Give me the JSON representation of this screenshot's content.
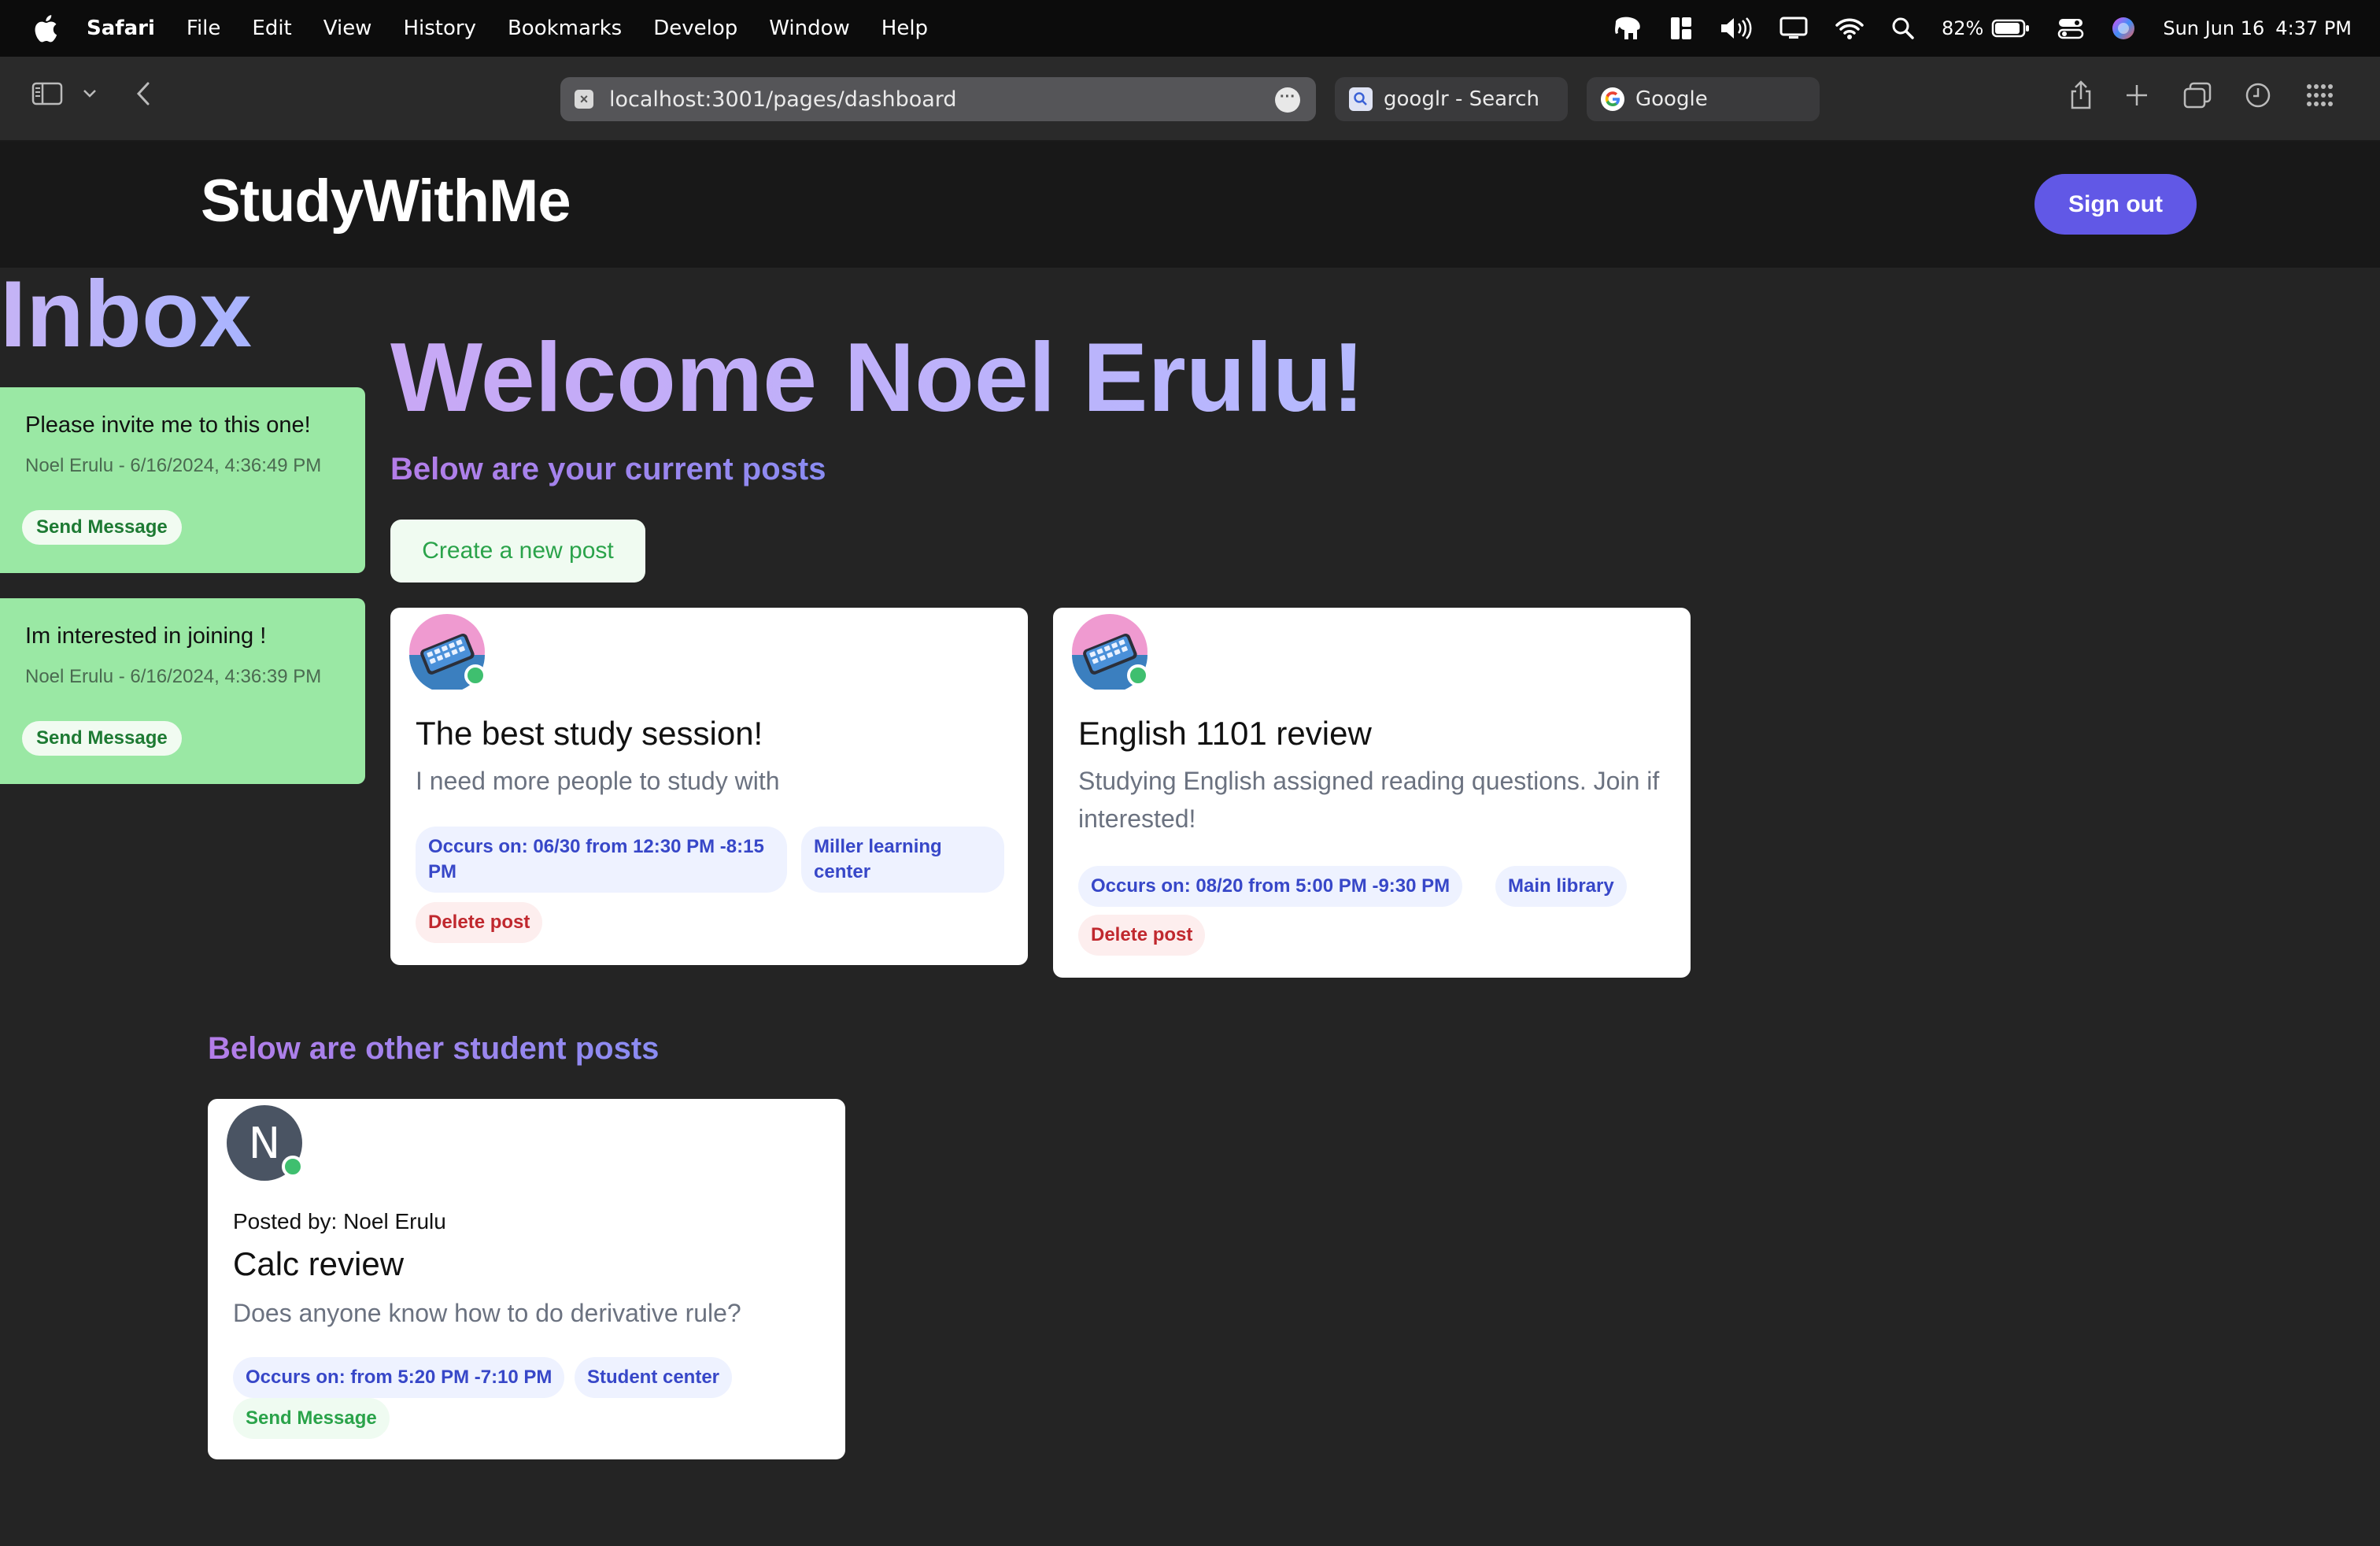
{
  "menubar": {
    "app_name": "Safari",
    "items": [
      "File",
      "Edit",
      "View",
      "History",
      "Bookmarks",
      "Develop",
      "Window",
      "Help"
    ],
    "battery": "82%",
    "date": "Sun Jun 16",
    "time": "4:37 PM"
  },
  "browser": {
    "url": "localhost:3001/pages/dashboard",
    "tabs": [
      {
        "label": "googlr - Search",
        "icon": "search-favicon"
      },
      {
        "label": "Google",
        "icon": "google-favicon"
      }
    ]
  },
  "header": {
    "brand": "StudyWithMe",
    "sign_out": "Sign out"
  },
  "inbox": {
    "title": "Inbox",
    "messages": [
      {
        "text": "Please invite me to this one!",
        "meta": "Noel Erulu - 6/16/2024, 4:36:49 PM",
        "button": "Send Message"
      },
      {
        "text": "Im interested in joining !",
        "meta": "Noel Erulu - 6/16/2024, 4:36:39 PM",
        "button": "Send Message"
      }
    ]
  },
  "main": {
    "welcome": "Welcome Noel Erulu!",
    "current_posts_heading": "Below are your current posts",
    "create_button": "Create a new post",
    "my_posts": [
      {
        "title": "The best study session!",
        "description": "I need more people to study with",
        "time_tag": "Occurs on: 06/30 from 12:30 PM -8:15 PM",
        "location_tag": "Miller learning center",
        "delete": "Delete post"
      },
      {
        "title": "English 1101 review",
        "description": "Studying English assigned reading questions. Join if interested!",
        "time_tag": "Occurs on: 08/20 from 5:00 PM -9:30 PM",
        "location_tag": "Main library",
        "delete": "Delete post"
      }
    ],
    "other_posts_heading": "Below are other student posts",
    "other_posts": [
      {
        "avatar_letter": "N",
        "posted_by": "Posted by: Noel Erulu",
        "title": "Calc review",
        "description": "Does anyone know how to do derivative rule?",
        "time_tag": "Occurs on: from 5:20 PM -7:10 PM",
        "location_tag": "Student center",
        "send": "Send Message"
      }
    ]
  },
  "colors": {
    "accent": "#6158e6",
    "inbox_card": "#9ae8a4",
    "online_dot": "#3fbf6f"
  }
}
